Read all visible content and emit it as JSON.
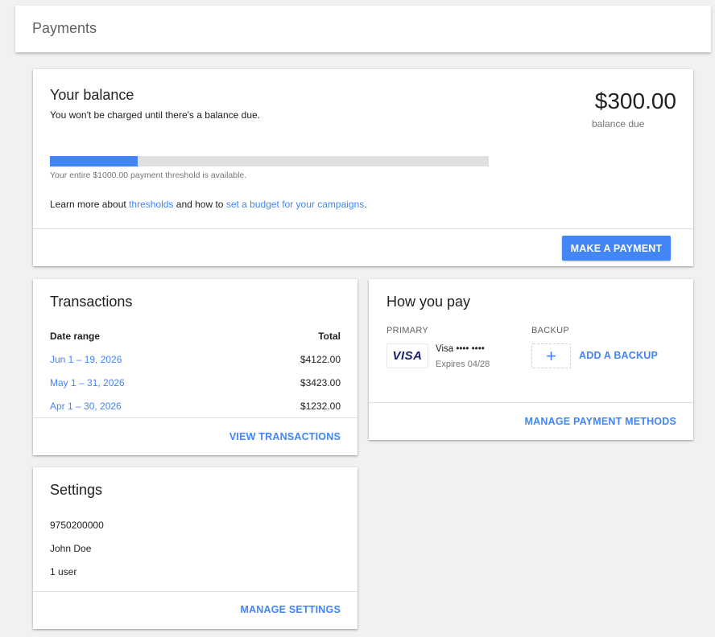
{
  "header": {
    "title": "Payments"
  },
  "balance": {
    "title": "Your balance",
    "subtitle": "You won't be charged until there's a balance due.",
    "amount": "$300.00",
    "amount_label": "balance due",
    "progress_fraction": 0.2,
    "threshold_note": "Your entire $1000.00 payment threshold is available.",
    "learn_prefix": "Learn more about ",
    "thresholds_link": "thresholds",
    "learn_middle": " and how to ",
    "budget_link": "set a budget for your campaigns",
    "learn_suffix": ".",
    "make_payment_label": "MAKE A PAYMENT"
  },
  "transactions": {
    "title": "Transactions",
    "columns": {
      "range": "Date range",
      "total": "Total"
    },
    "rows": [
      {
        "range": "Jun 1 – 19, 2026",
        "total": "$4122.00"
      },
      {
        "range": "May 1 – 31, 2026",
        "total": "$3423.00"
      },
      {
        "range": "Apr 1 – 30, 2026",
        "total": "$1232.00"
      }
    ],
    "view_label": "VIEW TRANSACTIONS"
  },
  "howpay": {
    "title": "How you pay",
    "primary_label": "PRIMARY",
    "backup_label": "BACKUP",
    "card_logo_text": "VISA",
    "card_name": "Visa •••• ••••",
    "card_expiry": "Expires 04/28",
    "add_backup_label": "ADD A BACKUP",
    "manage_label": "MANAGE PAYMENT METHODS"
  },
  "settings": {
    "title": "Settings",
    "account_id": "9750200000",
    "name": "John Doe",
    "users_link": "1 user",
    "manage_label": "MANAGE SETTINGS"
  },
  "colors": {
    "accent": "#4285f4",
    "background": "#f1f1f1"
  }
}
